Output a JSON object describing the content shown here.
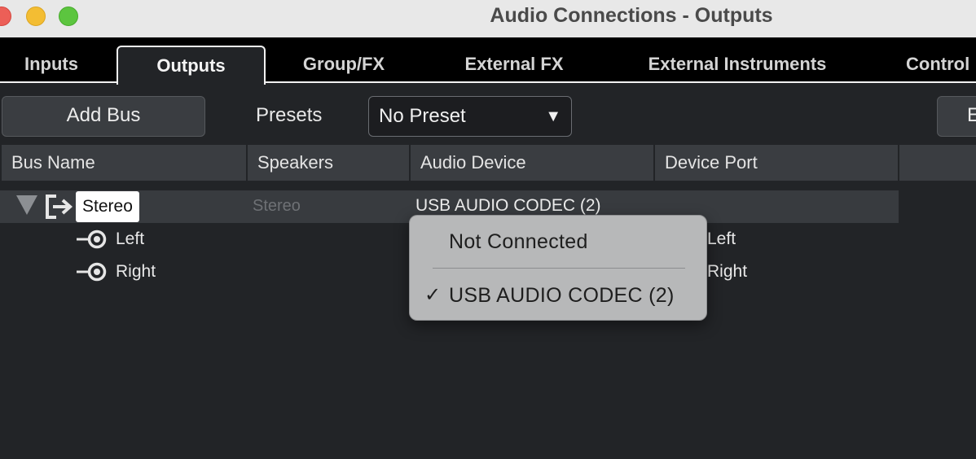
{
  "window": {
    "title": "Audio Connections - Outputs"
  },
  "tabs": [
    {
      "label": "Inputs",
      "active": false
    },
    {
      "label": "Outputs",
      "active": true
    },
    {
      "label": "Group/FX",
      "active": false
    },
    {
      "label": "External FX",
      "active": false
    },
    {
      "label": "External Instruments",
      "active": false
    },
    {
      "label": "Control",
      "active": false
    }
  ],
  "toolbar": {
    "add_bus_label": "Add Bus",
    "presets_label": "Presets",
    "preset_value": "No Preset",
    "right_button_label": "E"
  },
  "columns": [
    "Bus Name",
    "Speakers",
    "Audio Device",
    "Device Port"
  ],
  "bus": {
    "name": "Stereo",
    "speakers": "Stereo",
    "audio_device": "USB AUDIO  CODEC (2)",
    "channels": [
      {
        "name": "Left",
        "device_port": "Left"
      },
      {
        "name": "Right",
        "device_port": "Right"
      }
    ]
  },
  "popup_menu": {
    "items": [
      {
        "label": "Not Connected",
        "checked": false
      },
      {
        "label": "USB AUDIO  CODEC (2)",
        "checked": true
      }
    ],
    "check_glyph": "✓"
  },
  "icons": {
    "expand": "triangle-down-icon",
    "output_bus": "output-bus-icon",
    "channel": "output-channel-icon",
    "dropdown": "dropdown-arrow-icon"
  },
  "colors": {
    "background": "#222427",
    "tab_bar": "#000000",
    "selection_tag": "#ffffff",
    "popup": "#b7b8b9"
  }
}
